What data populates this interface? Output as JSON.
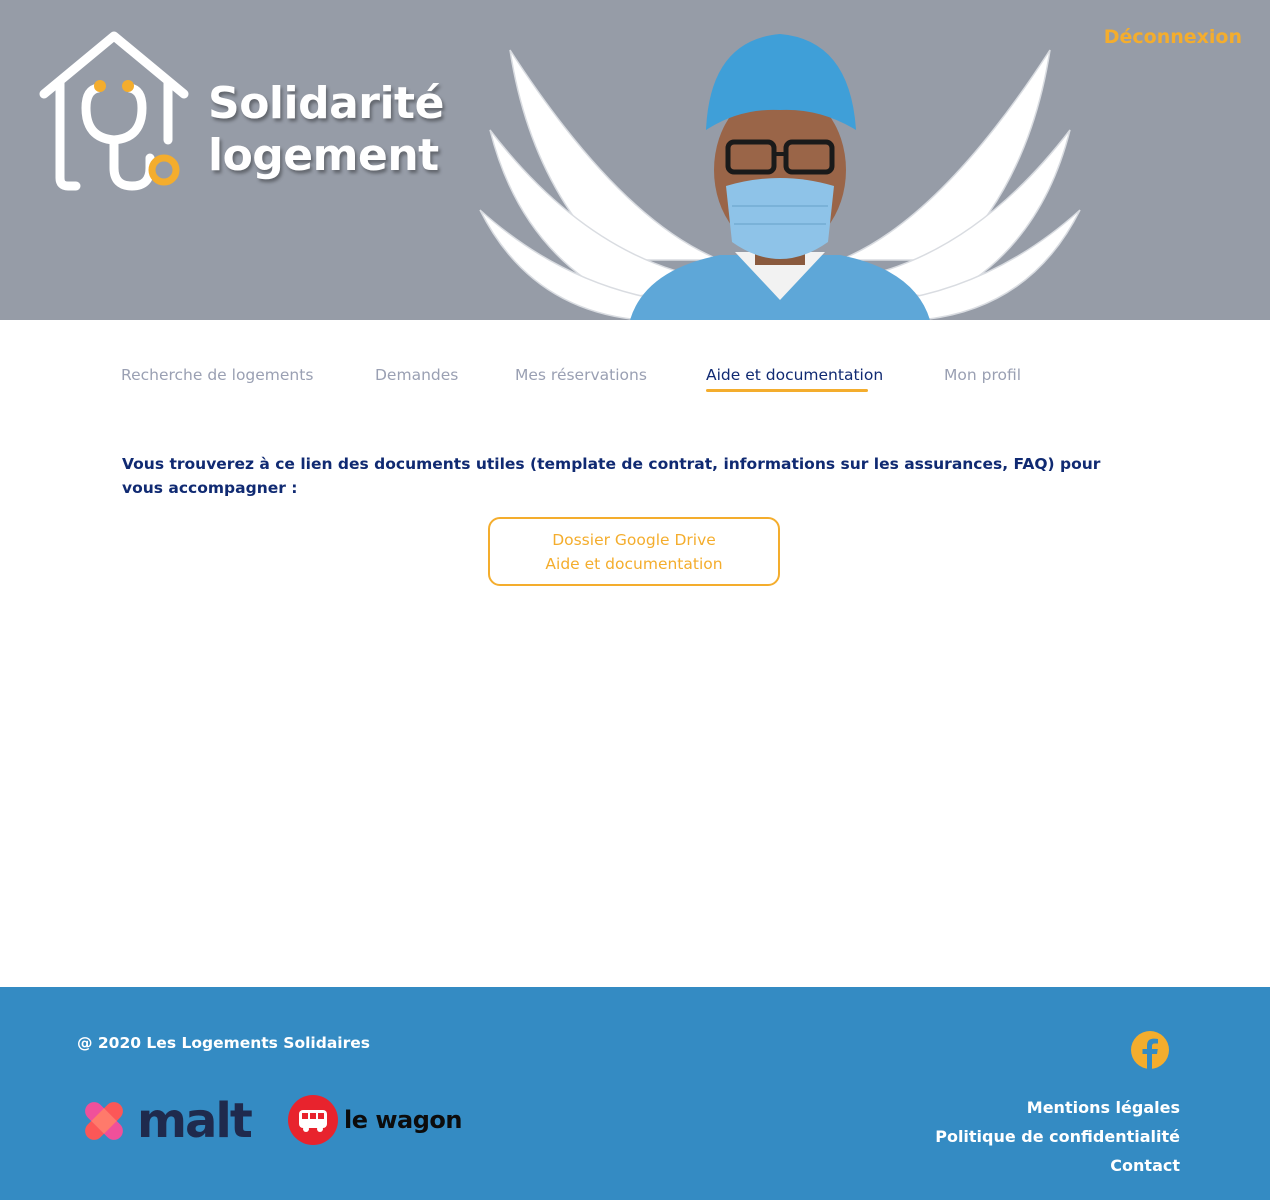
{
  "header": {
    "brand_line1": "Solidarité",
    "brand_line2": "logement",
    "logout_label": "Déconnexion"
  },
  "nav": {
    "tabs": [
      {
        "label": "Recherche de logements",
        "active": false
      },
      {
        "label": "Demandes",
        "active": false
      },
      {
        "label": "Mes réservations",
        "active": false
      },
      {
        "label": "Aide et documentation",
        "active": true
      },
      {
        "label": "Mon profil",
        "active": false
      }
    ]
  },
  "main": {
    "intro_text": "Vous trouverez à ce lien des documents utiles (template de contrat, informations sur les assurances, FAQ) pour vous accompagner :",
    "drive_button_line1": "Dossier Google Drive",
    "drive_button_line2": "Aide et documentation"
  },
  "footer": {
    "copyright": "@ 2020 Les Logements Solidaires",
    "partners": {
      "malt": "malt",
      "wagon": "le wagon"
    },
    "links": {
      "legal": "Mentions légales",
      "privacy": "Politique de confidentialité",
      "contact": "Contact"
    },
    "social_icon": "facebook-icon"
  },
  "colors": {
    "header_bg": "#969ca7",
    "accent": "#f4ad2d",
    "primary_text": "#102a72",
    "inactive_tab": "#9aa0b3",
    "footer_bg": "#348bc3"
  }
}
